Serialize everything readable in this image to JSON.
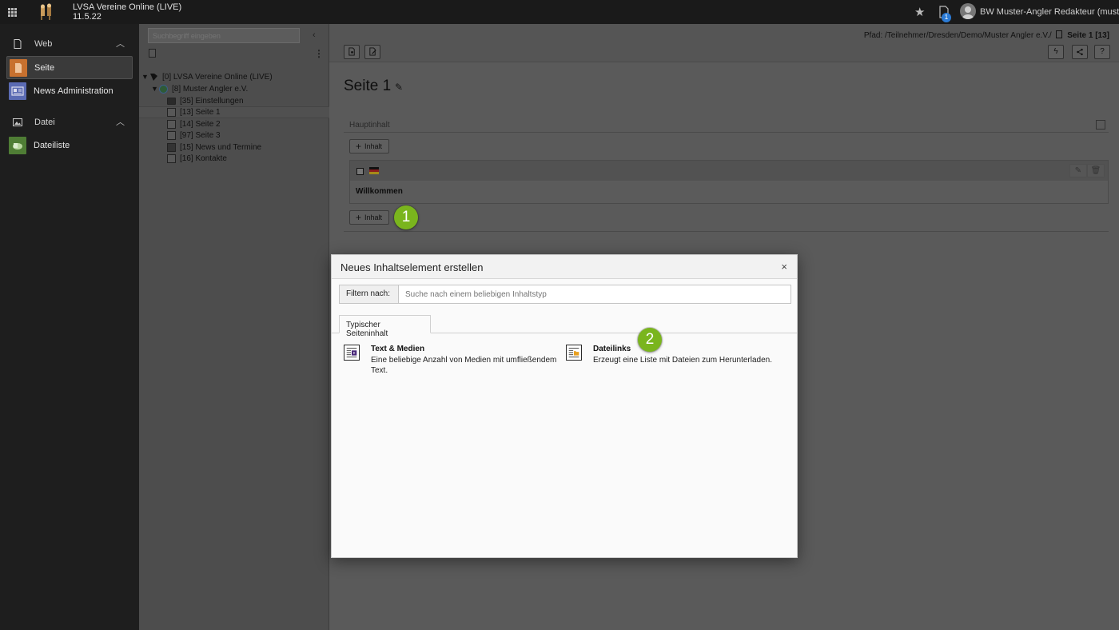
{
  "topbar": {
    "site_name": "LVSA Vereine Online (LIVE)",
    "site_version": "11.5.22",
    "bookmark_icon": "star-icon",
    "open_docs_count": "1",
    "user_name": "BW Muster-Angler Redakteur (muster-..."
  },
  "modules": {
    "groups": [
      {
        "label": "Web",
        "icon": "page-icon"
      },
      {
        "label": "Datei",
        "icon": "image-icon"
      }
    ],
    "items": [
      {
        "label": "Seite",
        "color": "#e47b33"
      },
      {
        "label": "News Administration",
        "color": "#5b6bb3"
      },
      {
        "label": "Dateiliste",
        "color": "#5a8a3c"
      }
    ]
  },
  "tree": {
    "search_placeholder": "Suchbegriff eingeben",
    "nodes": [
      {
        "label": "[0] LVSA Vereine Online (LIVE)"
      },
      {
        "label": "[8] Muster Angler e.V."
      },
      {
        "label": "[35] Einstellungen"
      },
      {
        "label": "[13] Seite 1"
      },
      {
        "label": "[14] Seite 2"
      },
      {
        "label": "[97] Seite 3"
      },
      {
        "label": "[15] News und Termine"
      },
      {
        "label": "[16] Kontakte"
      }
    ]
  },
  "content": {
    "path_label": "Pfad: /Teilnehmer/Dresden/Demo/Muster Angler e.V./",
    "path_current": "Seite 1 [13]",
    "page_title": "Seite 1",
    "column_name": "Hauptinhalt",
    "add_content_label": "Inhalt",
    "element_title": "Willkommen"
  },
  "steps": {
    "step1": "1",
    "step2": "2"
  },
  "modal": {
    "title": "Neues Inhaltselement erstellen",
    "close": "×",
    "filter_label": "Filtern nach:",
    "filter_placeholder": "Suche nach einem beliebigen Inhaltstyp",
    "tab_label": "Typischer Seiteninhalt",
    "wizards": [
      {
        "name": "Text & Medien",
        "description": "Eine beliebige Anzahl von Medien mit umfließendem Text."
      },
      {
        "name": "Dateilinks",
        "description": "Erzeugt eine Liste mit Dateien zum Herunterladen."
      }
    ]
  }
}
